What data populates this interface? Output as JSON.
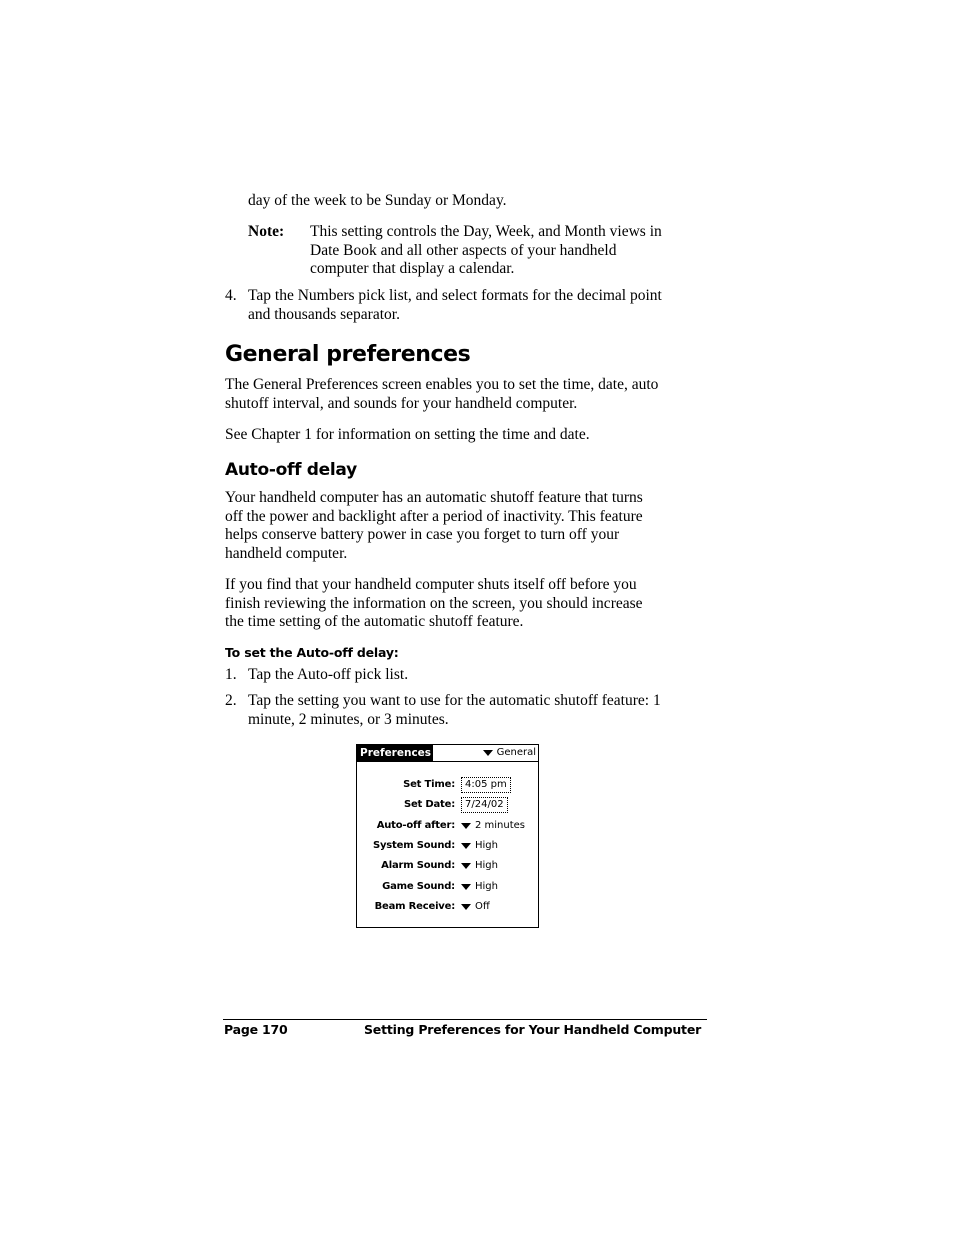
{
  "intro_continuation": "day of the week to be Sunday or Monday.",
  "note": {
    "label": "Note:",
    "lines": [
      "This setting controls the Day, Week, and Month views in",
      "Date Book and all other aspects of your handheld",
      "computer that display a calendar."
    ]
  },
  "step4": {
    "number": "4.",
    "lines": [
      "Tap the Numbers pick list, and select formats for the decimal point",
      "and thousands separator."
    ]
  },
  "section": {
    "title": "General preferences",
    "intro_lines": [
      "The General Preferences screen enables you to set the time, date, auto",
      "shutoff interval, and sounds for your handheld computer."
    ],
    "see_chapter": "See Chapter 1 for information on setting the time and date."
  },
  "subsection": {
    "title": "Auto-off delay",
    "para1_lines": [
      "Your handheld computer has an automatic shutoff feature that turns",
      "off the power and backlight after a period of inactivity. This feature",
      "helps conserve battery power in case you forget to turn off your",
      "handheld computer."
    ],
    "para2_lines": [
      "If you find that your handheld computer shuts itself off before you",
      "finish reviewing the information on the screen, you should increase",
      "the time setting of the automatic shutoff feature."
    ],
    "procedure_title": "To set the Auto-off delay:",
    "steps": [
      {
        "number": "1.",
        "lines": [
          "Tap the Auto-off pick list."
        ]
      },
      {
        "number": "2.",
        "lines": [
          "Tap the setting you want to use for the automatic shutoff feature: 1",
          "minute, 2 minutes, or 3 minutes."
        ]
      }
    ]
  },
  "palm_screen": {
    "title": "Preferences",
    "category": "General",
    "category_icon": "triangle-down-icon",
    "rows": [
      {
        "label": "Set Time:",
        "value": "4:05 pm",
        "kind": "box"
      },
      {
        "label": "Set Date:",
        "value": "7/24/02",
        "kind": "box"
      },
      {
        "label": "Auto-off after:",
        "value": "2 minutes",
        "kind": "picklist"
      },
      {
        "label": "System Sound:",
        "value": "High",
        "kind": "picklist"
      },
      {
        "label": "Alarm Sound:",
        "value": "High",
        "kind": "picklist"
      },
      {
        "label": "Game Sound:",
        "value": "High",
        "kind": "picklist"
      },
      {
        "label": "Beam Receive:",
        "value": "Off",
        "kind": "picklist"
      }
    ]
  },
  "footer": {
    "page": "Page 170",
    "chapter": "Setting Preferences for Your Handheld Computer"
  }
}
